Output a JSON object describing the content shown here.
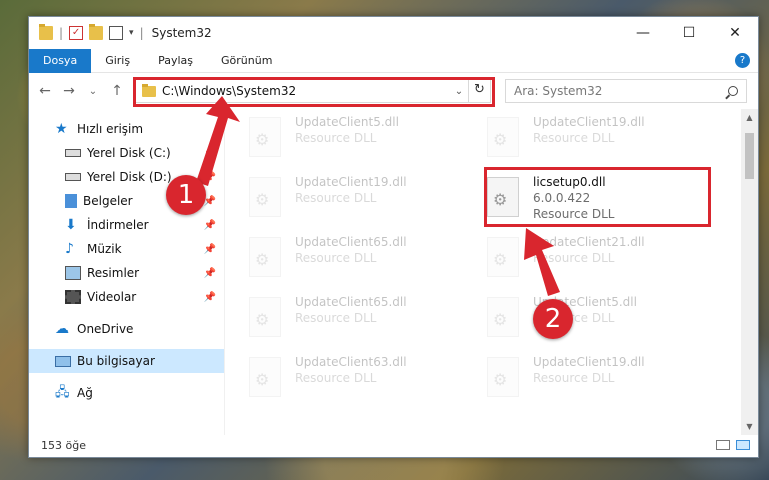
{
  "window": {
    "title": "System32",
    "controls": {
      "minimize": "—",
      "maximize": "☐",
      "close": "✕"
    }
  },
  "ribbon": {
    "tabs": [
      {
        "label": "Dosya",
        "active": true
      },
      {
        "label": "Giriş"
      },
      {
        "label": "Paylaş"
      },
      {
        "label": "Görünüm"
      }
    ],
    "help": "?"
  },
  "nav": {
    "back": "←",
    "forward": "→",
    "recent": "⌄",
    "up": "↑",
    "address": "C:\\Windows\\System32",
    "address_dropdown": "⌄",
    "refresh": "↻",
    "search_placeholder": "Ara: System32"
  },
  "sidebar": {
    "quick_access": "Hızlı erişim",
    "items": [
      {
        "label": "Yerel Disk (C:)",
        "icon": "drive-icon",
        "pinned": true
      },
      {
        "label": "Yerel Disk (D:)",
        "icon": "drive-icon",
        "pinned": true
      },
      {
        "label": "Belgeler",
        "icon": "documents-icon",
        "pinned": true
      },
      {
        "label": "İndirmeler",
        "icon": "downloads-icon",
        "pinned": true
      },
      {
        "label": "Müzik",
        "icon": "music-icon",
        "pinned": true
      },
      {
        "label": "Resimler",
        "icon": "pictures-icon",
        "pinned": true
      },
      {
        "label": "Videolar",
        "icon": "videos-icon",
        "pinned": true
      }
    ],
    "onedrive": "OneDrive",
    "this_pc": "Bu bilgisayar",
    "network": "Ağ"
  },
  "files": {
    "left_column": [
      {
        "name": "UpdateClient5.dll",
        "type": "Resource DLL"
      },
      {
        "name": "UpdateClient19.dll",
        "type": "Resource DLL"
      },
      {
        "name": "UpdateClient65.dll",
        "type": "Resource DLL"
      },
      {
        "name": "UpdateClient65.dll",
        "type": "Resource DLL"
      },
      {
        "name": "UpdateClient63.dll",
        "type": "Resource DLL"
      }
    ],
    "right_column": [
      {
        "name": "UpdateClient19.dll",
        "type": "Resource DLL"
      },
      {
        "name": "licsetup0.dll",
        "version": "6.0.0.422",
        "type": "Resource DLL",
        "highlighted": true
      },
      {
        "name": "UpdateClient21.dll",
        "type": "Resource DLL"
      },
      {
        "name": "UpdateClient5.dll",
        "type": "Resource DLL"
      },
      {
        "name": "UpdateClient19.dll",
        "type": "Resource DLL"
      }
    ]
  },
  "status": {
    "count": "153 öğe"
  },
  "annotations": {
    "badge1": "1",
    "badge2": "2",
    "color": "#d9262e"
  }
}
